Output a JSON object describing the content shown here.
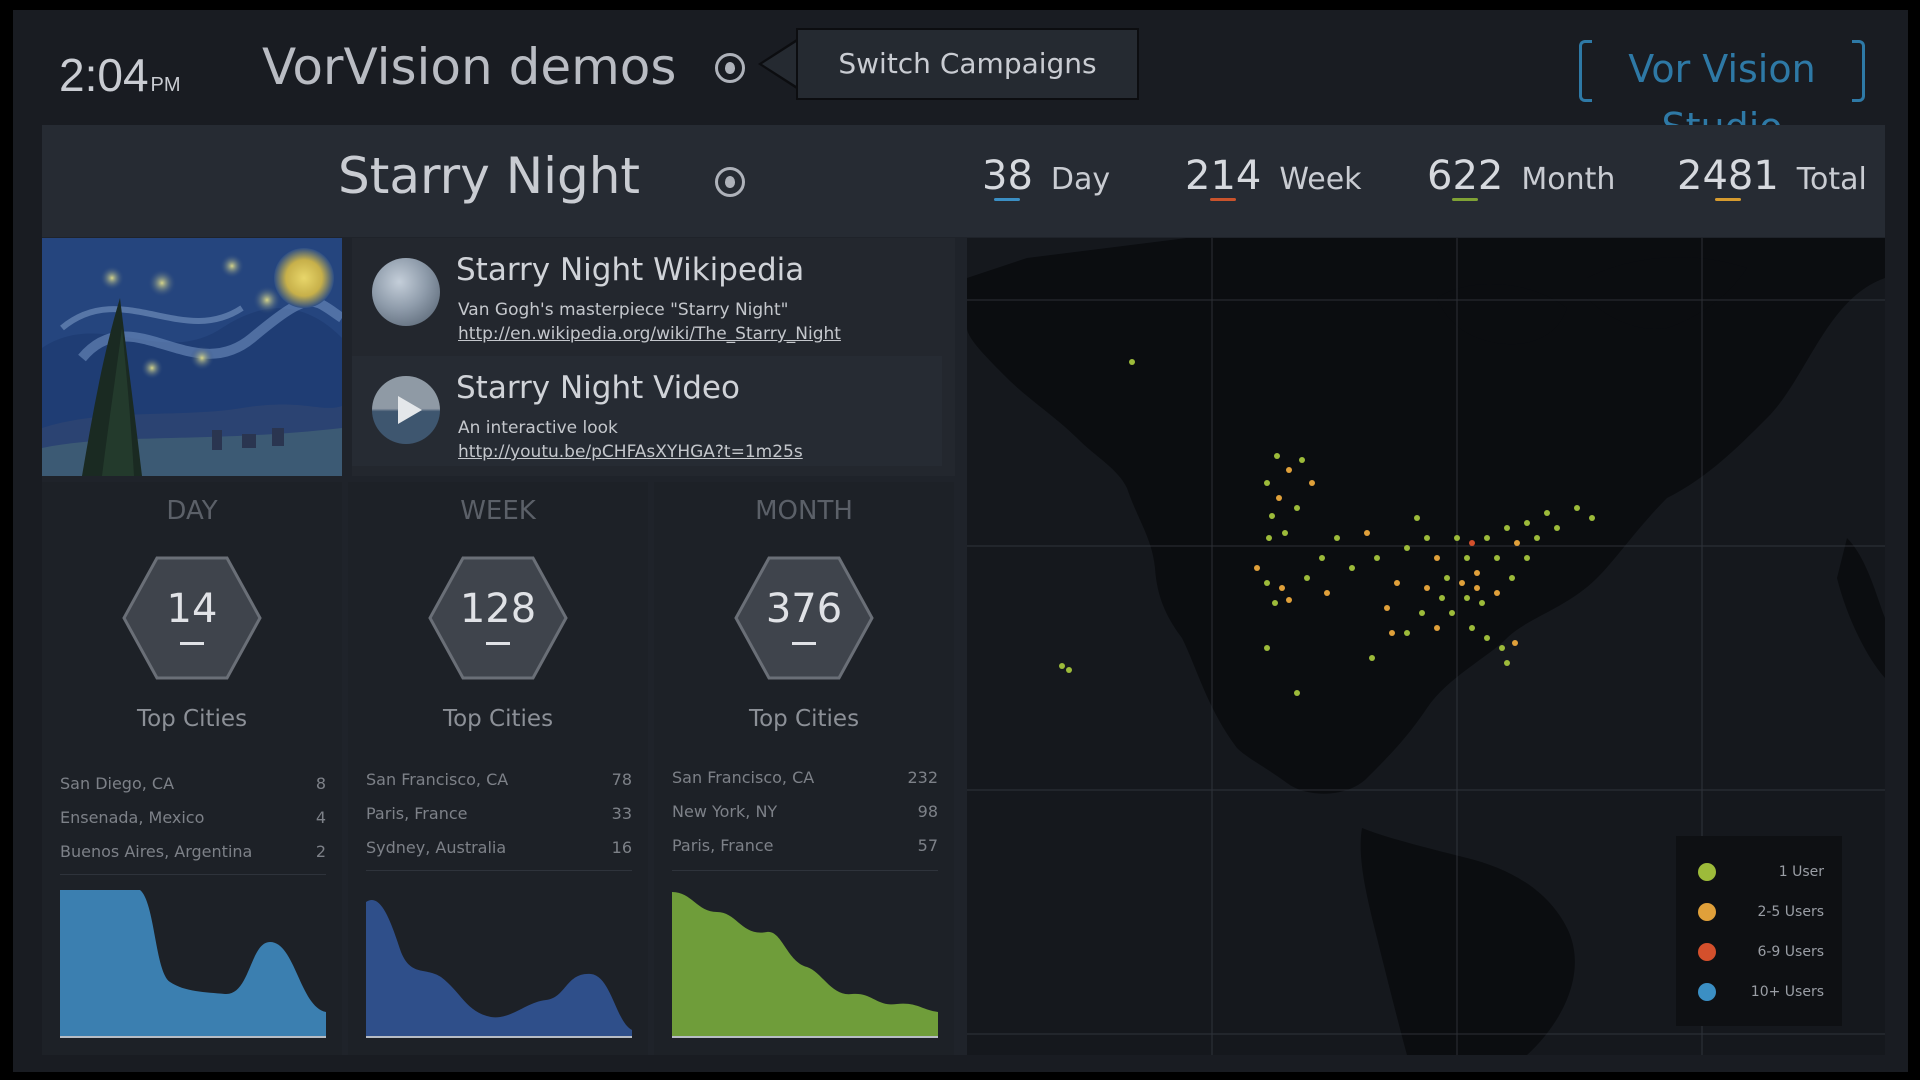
{
  "header": {
    "time": "2:04",
    "ampm": "PM",
    "app_title": "VorVision demos",
    "switch_campaigns": "Switch Campaigns",
    "brand": "Vor Vision Studio"
  },
  "campaign": {
    "name": "Starry Night",
    "stats": [
      {
        "value": "38",
        "label": "Day",
        "color": "#3b8fc4"
      },
      {
        "value": "214",
        "label": "Week",
        "color": "#c9532c"
      },
      {
        "value": "622",
        "label": "Month",
        "color": "#7fa235"
      },
      {
        "value": "2481",
        "label": "Total",
        "color": "#d69b2f"
      }
    ]
  },
  "links": [
    {
      "title": "Starry Night Wikipedia",
      "desc": "Van Gogh's masterpiece \"Starry Night\"",
      "url": "http://en.wikipedia.org/wiki/The_Starry_Night",
      "icon": "globe-icon"
    },
    {
      "title": "Starry Night Video",
      "desc": "An interactive look",
      "url": "http://youtu.be/pCHFAsXYHGA?t=1m25s",
      "icon": "play-icon"
    }
  ],
  "panels": [
    {
      "title": "DAY",
      "count": "14",
      "top_cities_label": "Top Cities",
      "cities": [
        {
          "name": "San Diego, CA",
          "count": "8"
        },
        {
          "name": "Ensenada, Mexico",
          "count": "4"
        },
        {
          "name": "Buenos Aires, Argentina",
          "count": "2"
        }
      ],
      "color": "#3b7fb0"
    },
    {
      "title": "WEEK",
      "count": "128",
      "top_cities_label": "Top Cities",
      "cities": [
        {
          "name": "San Francisco, CA",
          "count": "78"
        },
        {
          "name": "Paris, France",
          "count": "33"
        },
        {
          "name": "Sydney, Australia",
          "count": "16"
        }
      ],
      "color": "#2f4f8a"
    },
    {
      "title": "MONTH",
      "count": "376",
      "top_cities_label": "Top Cities",
      "cities": [
        {
          "name": "San Francisco, CA",
          "count": "232"
        },
        {
          "name": "New York, NY",
          "count": "98"
        },
        {
          "name": "Paris, France",
          "count": "57"
        }
      ],
      "color": "#6f9d3a"
    }
  ],
  "legend": [
    {
      "label": "1 User",
      "color": "#9dbb3a"
    },
    {
      "label": "2-5 Users",
      "color": "#e0a03a"
    },
    {
      "label": "6-9 Users",
      "color": "#d4502c"
    },
    {
      "label": "10+ Users",
      "color": "#3b8fc4"
    }
  ]
}
